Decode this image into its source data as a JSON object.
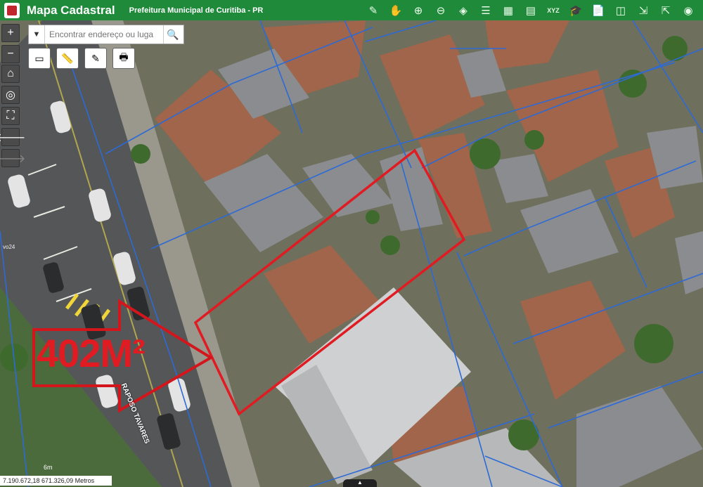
{
  "app": {
    "title": "Mapa Cadastral",
    "subtitle": "Prefeitura Municipal de Curitiba - PR"
  },
  "toolbar": {
    "icons": [
      "pin-icon",
      "hand-icon",
      "zoom-in-icon",
      "zoom-out-icon",
      "layers-icon",
      "list-icon",
      "grid-icon",
      "table-icon",
      "xyz-icon",
      "graduation-icon",
      "document-icon",
      "split-icon",
      "login-icon",
      "logout-icon",
      "gps-icon"
    ],
    "xyz_label": "XYZ"
  },
  "search": {
    "placeholder": "Encontrar endereço ou luga"
  },
  "map": {
    "area_label": "402M²",
    "street_label": "RAPOSO TAVARES",
    "scale_label": "6m",
    "coordinates": "7.190.672,18 671.326,09 Metros",
    "lot_number": "vo24",
    "colors": {
      "highlight": "#e11b22",
      "parcel_lines": "#2d6ad6",
      "arrow": "#d3161c"
    }
  },
  "leftbar": {
    "buttons": [
      "+",
      "−",
      "⌂",
      "◎",
      "⛶",
      "🡐",
      "🡒"
    ]
  }
}
